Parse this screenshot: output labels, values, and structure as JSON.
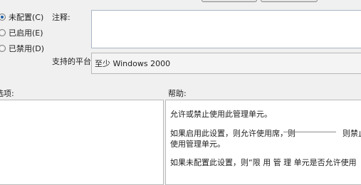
{
  "policy": {
    "options": [
      {
        "label": "未配置(C)",
        "checked": true
      },
      {
        "label": "已启用(E)",
        "checked": false
      },
      {
        "label": "已禁用(D)",
        "checked": false
      }
    ],
    "comment_label": "注释:",
    "supported_label": "支持的平台:",
    "supported_value": "至少 Windows 2000"
  },
  "sections": {
    "options_label": "选项:",
    "help_label": "帮助:"
  },
  "help": {
    "lines": [
      "允许或禁止使用此管理单元。",
      "如果启用此设置，则允许使用席，则",
      "则禁止",
      "使用管理单元。",
      "如果未配置此设置，则“限    用    管 理 单元是否允许使用"
    ]
  }
}
